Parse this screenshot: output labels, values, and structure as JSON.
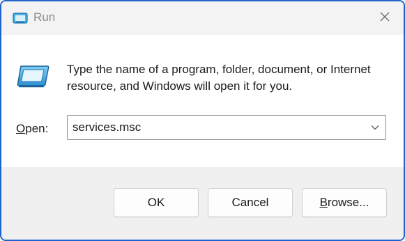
{
  "window": {
    "title": "Run",
    "accent_color": "#1e63c9"
  },
  "icons": {
    "app": "run-app-icon",
    "close": "close-icon",
    "dropdown": "chevron-down-icon"
  },
  "content": {
    "description": "Type the name of a program, folder, document, or Internet resource, and Windows will open it for you.",
    "open_label_mnemonic": "O",
    "open_label_rest": "pen:",
    "open_value": "services.msc"
  },
  "buttons": {
    "ok": "OK",
    "cancel": "Cancel",
    "browse_mnemonic": "B",
    "browse_rest": "rowse..."
  }
}
